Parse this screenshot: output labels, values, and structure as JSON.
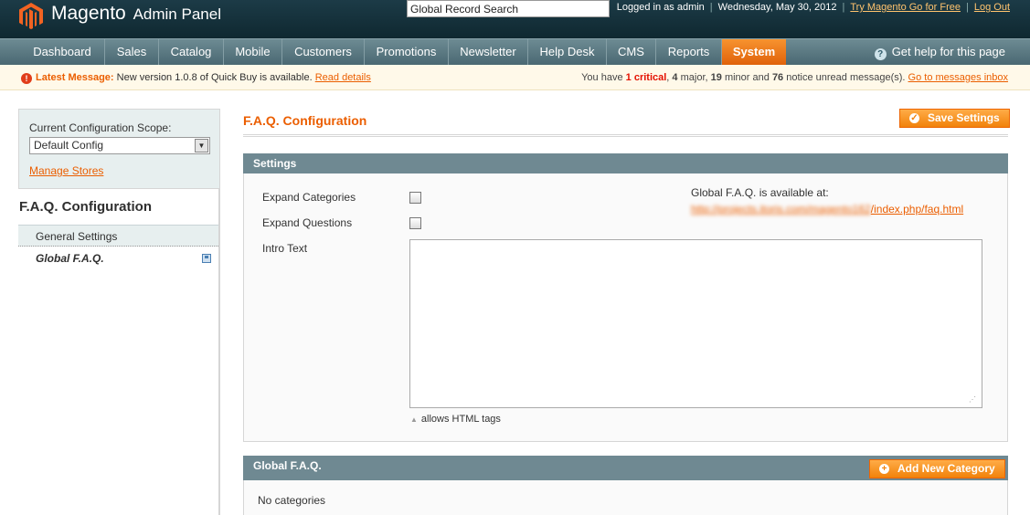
{
  "header": {
    "logo_text": "Magento",
    "logo_sub": "Admin Panel",
    "search_value": "Global Record Search",
    "logged_in": "Logged in as admin",
    "date": "Wednesday, May 30, 2012",
    "try_link": "Try Magento Go for Free",
    "logout": "Log Out"
  },
  "nav": {
    "items": [
      "Dashboard",
      "Sales",
      "Catalog",
      "Mobile",
      "Customers",
      "Promotions",
      "Newsletter",
      "Help Desk",
      "CMS",
      "Reports",
      "System"
    ],
    "active": "System",
    "help": "Get help for this page"
  },
  "message": {
    "title": "Latest Message:",
    "text": "New version 1.0.8 of Quick Buy is available.",
    "link": "Read details",
    "summary_prefix": "You have",
    "critical_count": "1 critical",
    "major": "4",
    "major_label": "major,",
    "minor": "19",
    "minor_label": "minor and",
    "notice": "76",
    "notice_label": "notice unread message(s).",
    "inbox_link": "Go to messages inbox"
  },
  "sidebar": {
    "scope_label": "Current Configuration Scope:",
    "scope_value": "Default Config",
    "manage_stores": "Manage Stores",
    "title": "F.A.Q. Configuration",
    "items": [
      {
        "label": "General Settings"
      },
      {
        "label": "Global F.A.Q."
      }
    ]
  },
  "main": {
    "title": "F.A.Q. Configuration",
    "save_button": "Save Settings",
    "settings": {
      "heading": "Settings",
      "expand_categories": "Expand Categories",
      "expand_questions": "Expand Questions",
      "intro_text": "Intro Text",
      "intro_note": "allows HTML tags",
      "available_label": "Global F.A.Q. is available at:",
      "url_hidden": "http://projects.itoris.com/magento162",
      "url_visible": "/index.php/faq.html"
    },
    "global": {
      "heading": "Global F.A.Q.",
      "add_button": "Add New Category",
      "empty": "No categories"
    }
  },
  "colors": {
    "accent": "#eb5e00",
    "header_bg": "#16313b",
    "nav_bg": "#5a7880",
    "fieldset_head": "#6f8992"
  }
}
